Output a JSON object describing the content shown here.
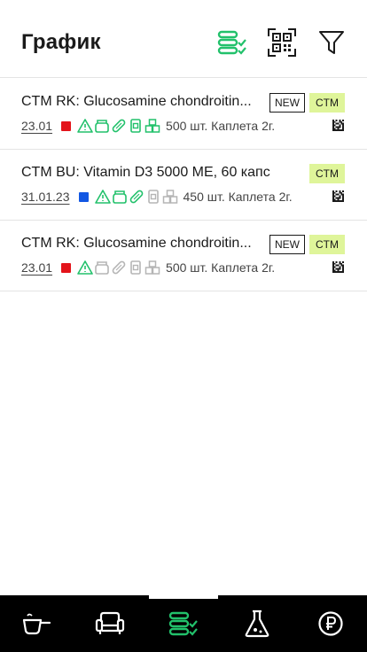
{
  "header": {
    "title": "График",
    "schedule_icon": "schedule-check-icon",
    "qr_icon": "qr-scan-icon",
    "filter_icon": "filter-icon"
  },
  "colors": {
    "accent_green": "#22c16b",
    "ctm_badge": "#dff59a",
    "inactive_icon": "#b5b5b5",
    "red": "#e3141b",
    "blue": "#1257e3"
  },
  "items": [
    {
      "title": "CTM RK: Glucosamine chondroitin...",
      "badge_new": "NEW",
      "badge_ctm": "CTM",
      "date": "23.01",
      "status_color": "#e3141b",
      "info": "500 шт. Каплета 2г.",
      "icons_active": [
        true,
        true,
        true,
        true,
        true
      ]
    },
    {
      "title": "CTM BU: Vitamin D3 5000 ME, 60 капс",
      "badge_ctm": "CTM",
      "date": "31.01.23",
      "status_color": "#1257e3",
      "info": "450 шт. Каплета 2г.",
      "icons_active": [
        true,
        true,
        true,
        false,
        false
      ]
    },
    {
      "title": "CTM RK: Glucosamine chondroitin...",
      "badge_new": "NEW",
      "badge_ctm": "CTM",
      "date": "23.01",
      "status_color": "#e3141b",
      "info": "500 шт. Каплета 2г.",
      "icons_active": [
        true,
        false,
        false,
        false,
        false
      ]
    }
  ],
  "nav": [
    {
      "icon": "scoop-icon",
      "active": false
    },
    {
      "icon": "armchair-icon",
      "active": false
    },
    {
      "icon": "schedule-check-icon",
      "active": true
    },
    {
      "icon": "flask-icon",
      "active": false
    },
    {
      "icon": "ruble-icon",
      "active": false
    }
  ]
}
